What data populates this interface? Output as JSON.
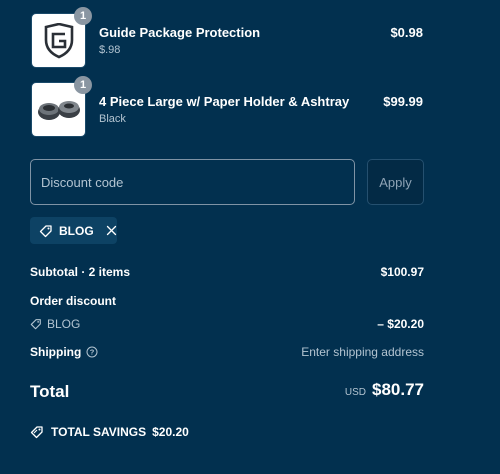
{
  "items": [
    {
      "quantity": "1",
      "title": "Guide Package Protection",
      "subtitle": "$.98",
      "price": "$0.98",
      "image_icon": "shield-logo-icon"
    },
    {
      "quantity": "1",
      "title": "4 Piece Large w/ Paper Holder & Ashtray",
      "subtitle": "Black",
      "price": "$99.99",
      "image_icon": "grinder-product-icon"
    }
  ],
  "discount": {
    "placeholder": "Discount code",
    "apply_label": "Apply",
    "applied_code": "BLOG"
  },
  "summary": {
    "subtotal_label": "Subtotal · 2 items",
    "subtotal_value": "$100.97",
    "order_discount_label": "Order discount",
    "discount_code": "BLOG",
    "discount_value": "– $20.20",
    "shipping_label": "Shipping",
    "shipping_value": "Enter shipping address",
    "total_label": "Total",
    "currency": "USD",
    "total_value": "$80.77",
    "savings_label": "TOTAL SAVINGS",
    "savings_value": "$20.20"
  },
  "colors": {
    "background": "#02304f",
    "text": "#ffffff",
    "muted_text": "#b3c4d1",
    "chip_background": "#0d4264",
    "badge": "#8a96a2"
  }
}
